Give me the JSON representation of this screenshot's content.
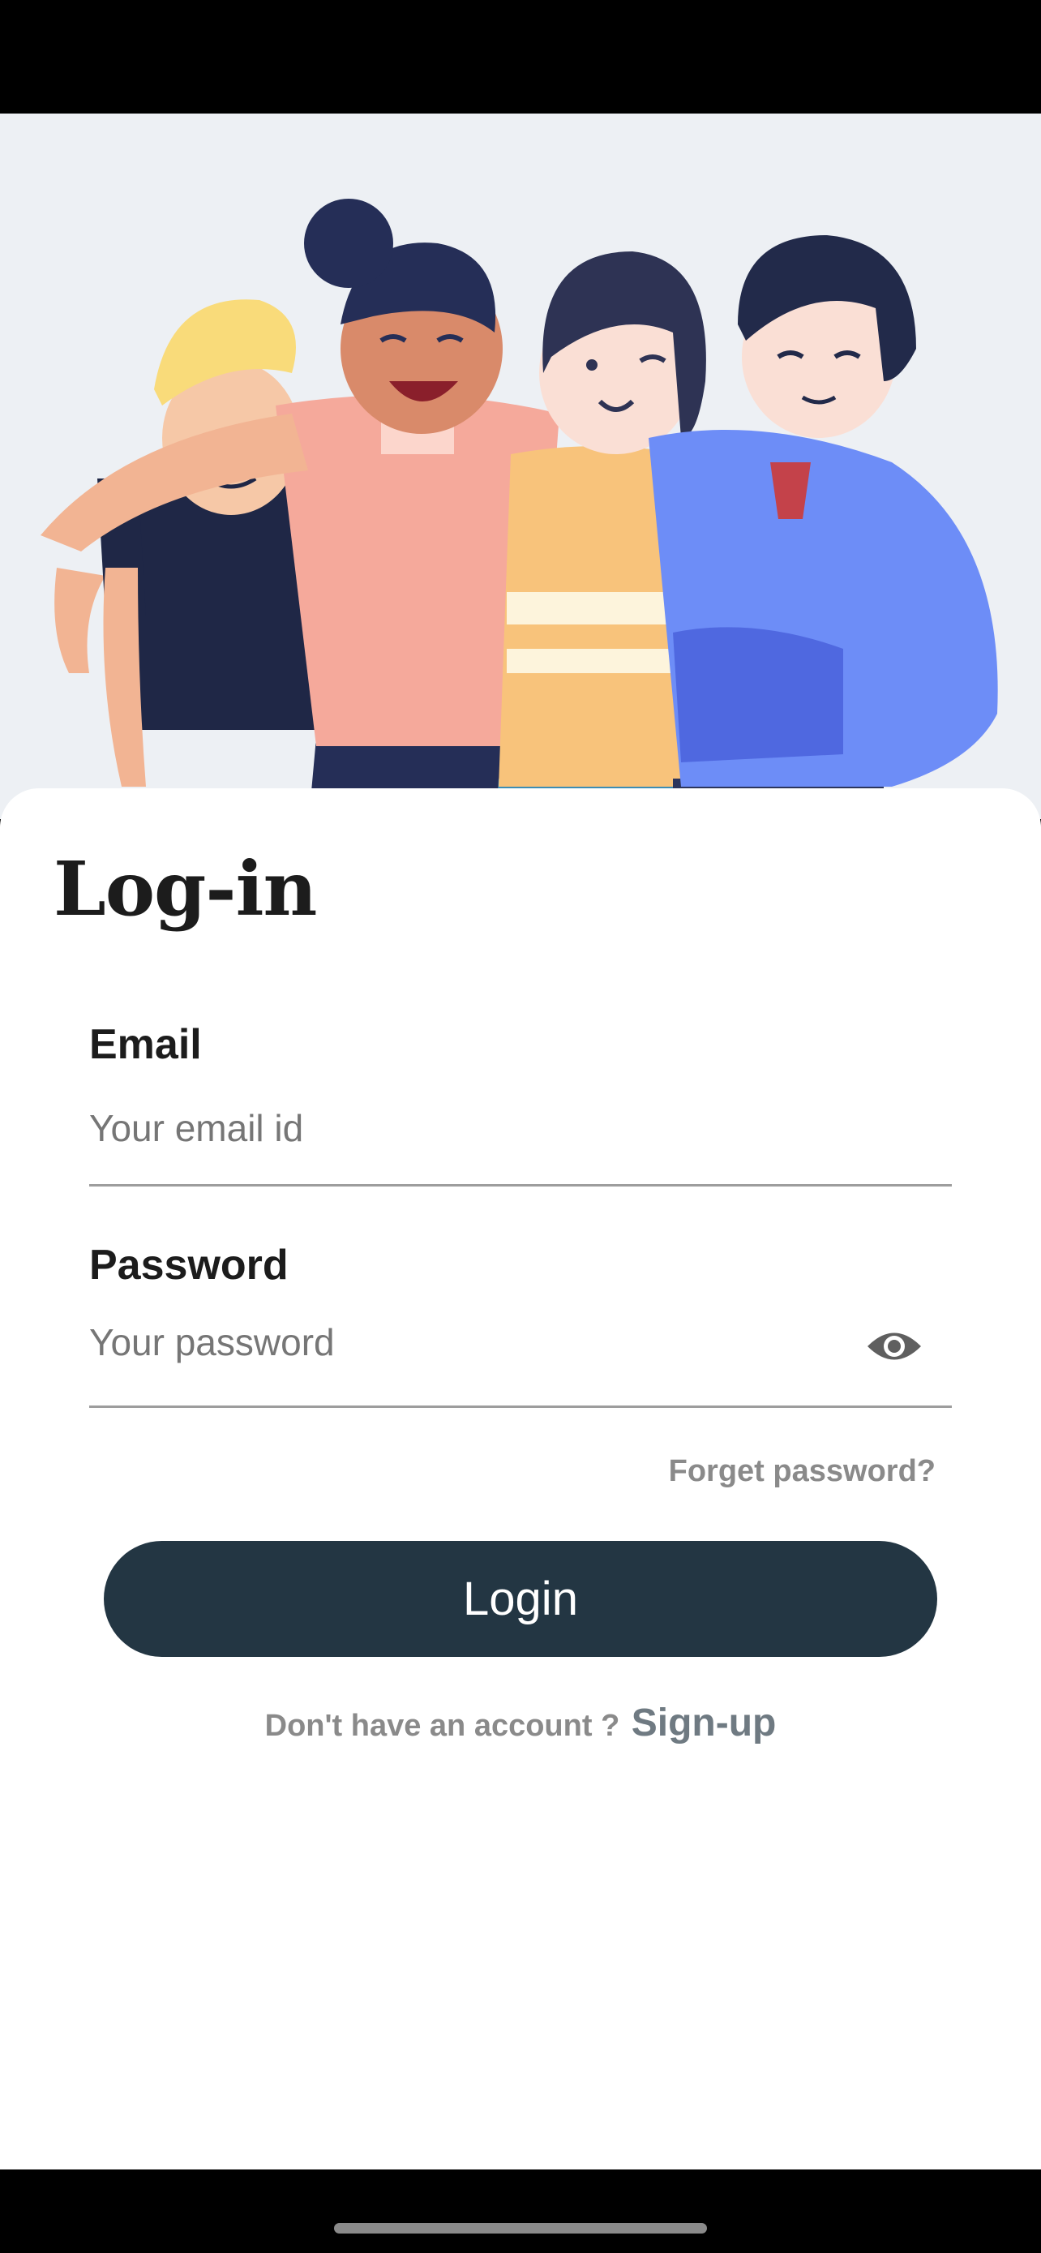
{
  "screen": {
    "title": "Log-in"
  },
  "form": {
    "email": {
      "label": "Email",
      "placeholder": "Your email id",
      "value": ""
    },
    "password": {
      "label": "Password",
      "placeholder": "Your password",
      "value": "",
      "toggle_icon": "eye-icon"
    },
    "forgot_label": "Forget password?",
    "login_label": "Login",
    "signup_prompt": "Don't have an account ?",
    "signup_label": "Sign-up"
  },
  "hero": {
    "illustration": "group-of-four-friends-illustration"
  },
  "colors": {
    "hero_background": "#edf0f4",
    "button_background": "#233643",
    "button_text": "#ffffff",
    "muted_text": "#8a8a8a"
  }
}
